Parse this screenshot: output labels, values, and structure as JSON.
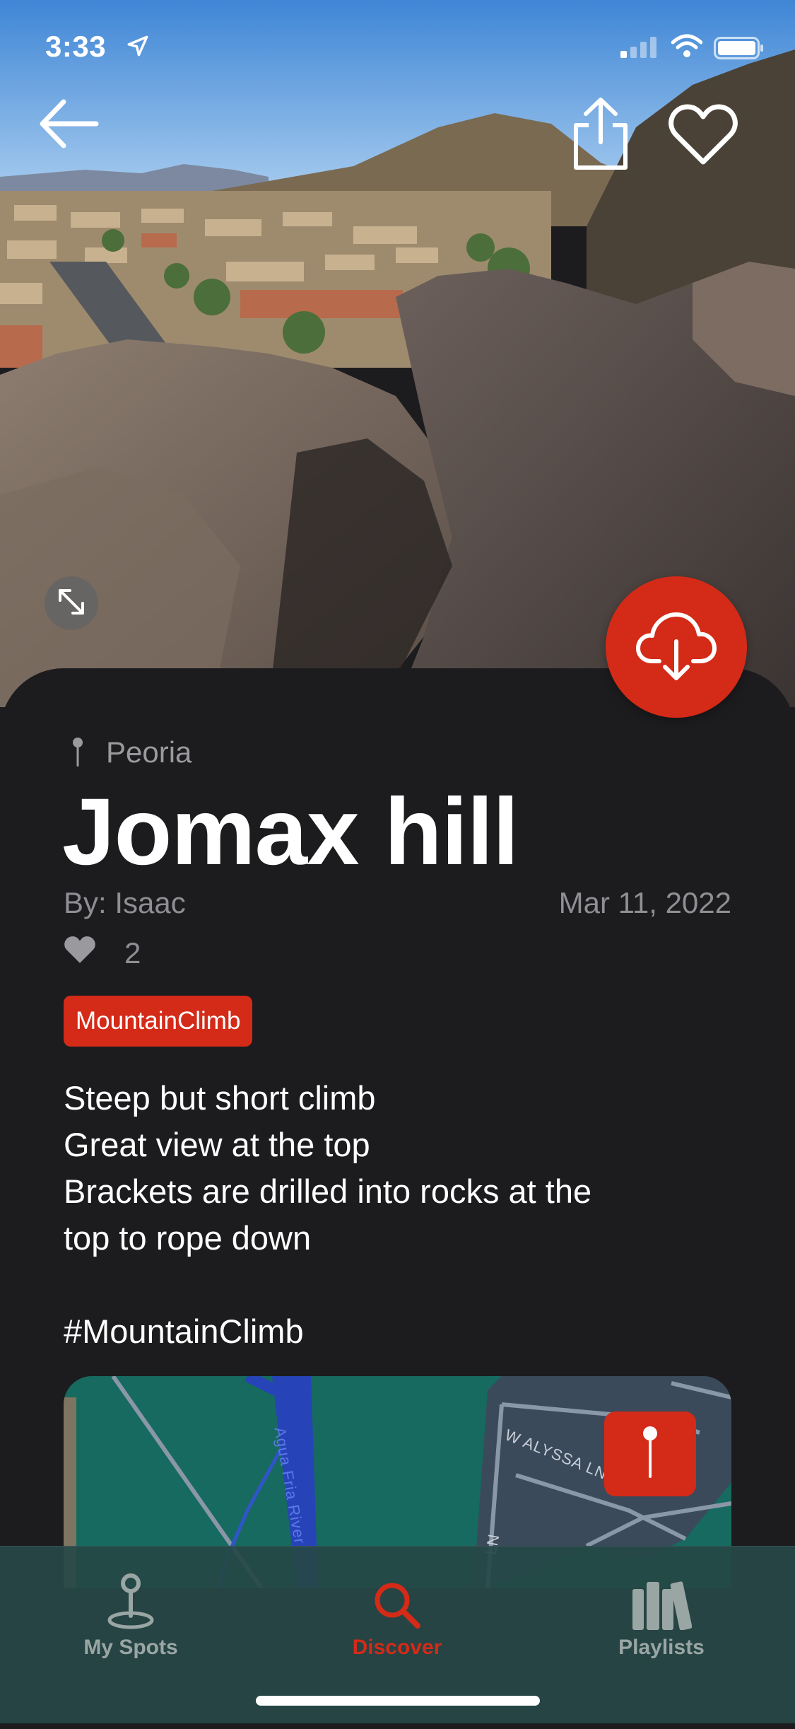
{
  "status_bar": {
    "time": "3:33"
  },
  "spot": {
    "city": "Peoria",
    "title": "Jomax hill",
    "author": "By: Isaac",
    "date": "Mar 11, 2022",
    "likes": "2",
    "tag": "MountainClimb",
    "description": [
      "Steep but short climb",
      "Great view at the top",
      "Brackets are drilled into rocks at the",
      "top to rope down",
      "",
      "#MountainClimb"
    ]
  },
  "map": {
    "street_label": "W ALYSSA LN",
    "river_label": "Agua Fria River",
    "small_label": "LN"
  },
  "tabs": [
    {
      "label": "My Spots",
      "icon": "map-pin-icon",
      "active": false
    },
    {
      "label": "Discover",
      "icon": "search-icon",
      "active": true
    },
    {
      "label": "Playlists",
      "icon": "library-icon",
      "active": false
    }
  ],
  "colors": {
    "accent": "#d42a18",
    "card": "#1c1c1e",
    "tabbar": "#264846"
  }
}
